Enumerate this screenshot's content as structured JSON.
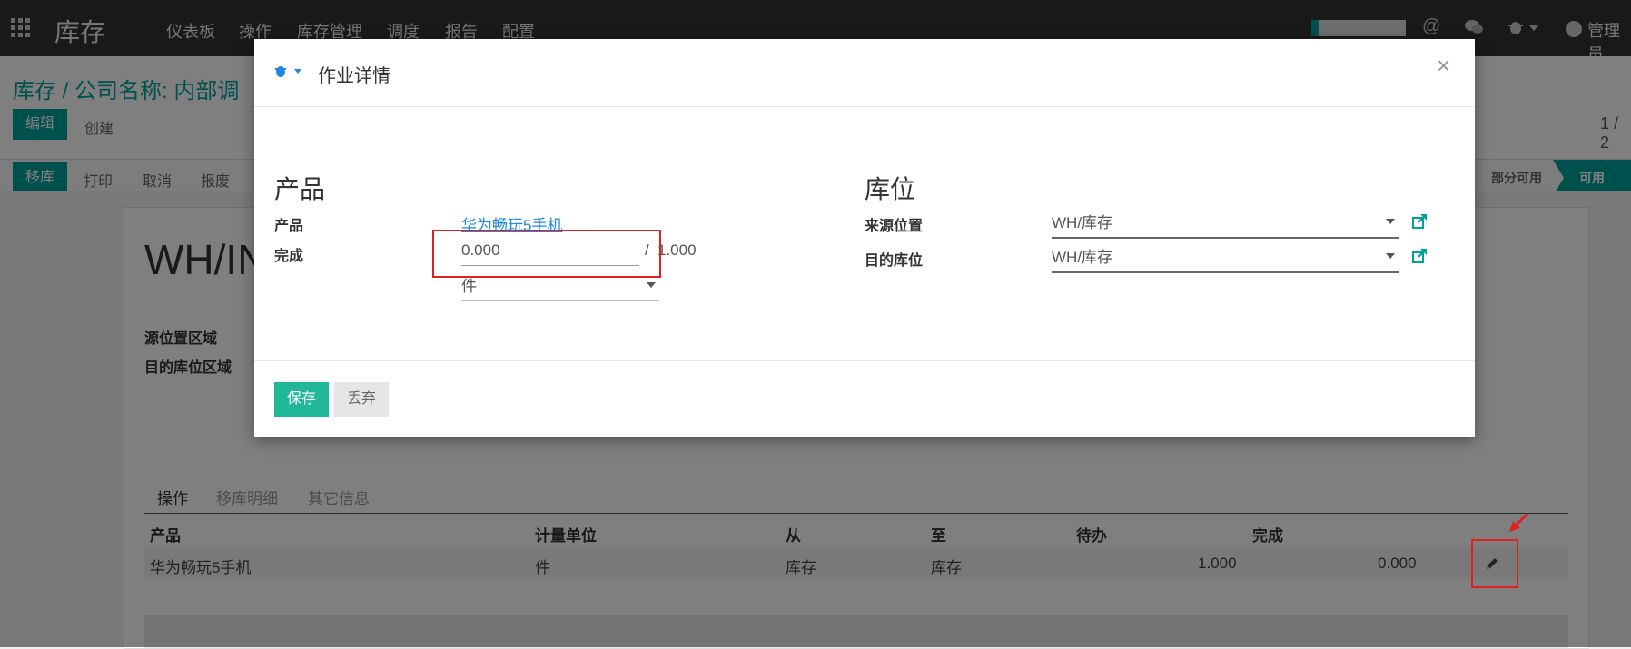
{
  "navbar": {
    "app_title": "库存",
    "menu": [
      "仪表板",
      "操作",
      "库存管理",
      "调度",
      "报告",
      "配置"
    ],
    "user": "管理员"
  },
  "control_panel": {
    "breadcrumb_root": "库存 /",
    "breadcrumb_current": "公司名称: 内部调",
    "edit_label": "编辑",
    "create_label": "创建",
    "pager": "1 / 2"
  },
  "statusbar": {
    "buttons": [
      "移库",
      "打印",
      "取消",
      "报废"
    ],
    "states": [
      "部分可用",
      "可用"
    ]
  },
  "sheet": {
    "name": "WH/IN",
    "field_source_zone": "源位置区域",
    "field_dest_zone": "目的库位区域",
    "tabs": [
      "操作",
      "移库明细",
      "其它信息"
    ],
    "table": {
      "headers": [
        "产品",
        "计量单位",
        "从",
        "至",
        "待办",
        "完成"
      ],
      "rows": [
        {
          "product": "华为畅玩5手机",
          "uom": "件",
          "from": "库存",
          "to": "库存",
          "todo": "1.000",
          "done": "0.000"
        }
      ]
    }
  },
  "modal": {
    "title": "作业详情",
    "close_glyph": "×",
    "product_section": "产品",
    "product_label": "产品",
    "product_value": "华为畅玩5手机",
    "done_label": "完成",
    "done_value": "0.000",
    "done_separator": "/",
    "done_total": "1.000",
    "uom_value": "件",
    "location_section": "库位",
    "source_label": "来源位置",
    "source_value": "WH/库存",
    "dest_label": "目的库位",
    "dest_value": "WH/库存",
    "save_label": "保存",
    "discard_label": "丢弃"
  },
  "colors": {
    "brand": "#00a09d",
    "link": "#00a09d",
    "navbar": "#333333",
    "highlight": "#e02020"
  },
  "icons": [
    "apps-grid-icon",
    "at-icon",
    "chat-icon",
    "bug-icon",
    "avatar-icon",
    "external-link-icon",
    "pencil-icon",
    "arrow-icon"
  ]
}
